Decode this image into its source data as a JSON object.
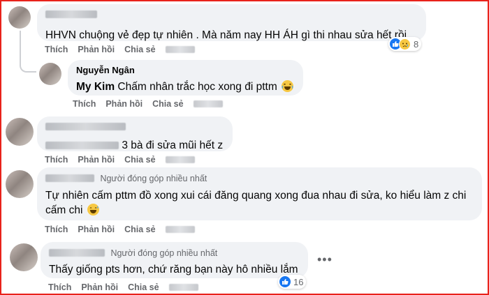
{
  "actions": {
    "like": "Thích",
    "reply": "Phản hồi",
    "share": "Chia sẻ"
  },
  "badge_top_contributor": "Người đóng góp nhiều nhất",
  "comments": [
    {
      "text": "HHVN chuộng vẻ đẹp tự nhiên . Mà năm nay HH ÁH gì thi nhau sửa hết rồi .",
      "reaction_count": "8",
      "reaction_icons": [
        "like-icon",
        "sad-icon"
      ]
    },
    {
      "author": "Nguyễn Ngân",
      "mention": "My Kim",
      "text": " Chấm nhân trắc học xong đi pttm "
    },
    {
      "text": "3 bà đi sửa mũi hết z"
    },
    {
      "text_line1": "Tự nhiên cấm pttm đồ xong xui cái đăng quang xong đua nhau đi sửa, ko hiểu làm z chi",
      "text_line2": "cấm chi "
    },
    {
      "text": "Thấy giống pts hơn, chứ răng bạn này hô nhiều lắm",
      "reaction_count": "16",
      "reaction_icons": [
        "like-icon"
      ]
    }
  ],
  "colors": {
    "border": "#e8221b",
    "bubble": "#f0f2f5",
    "like_blue": "#1877f2",
    "secondary_text": "#65676b"
  }
}
